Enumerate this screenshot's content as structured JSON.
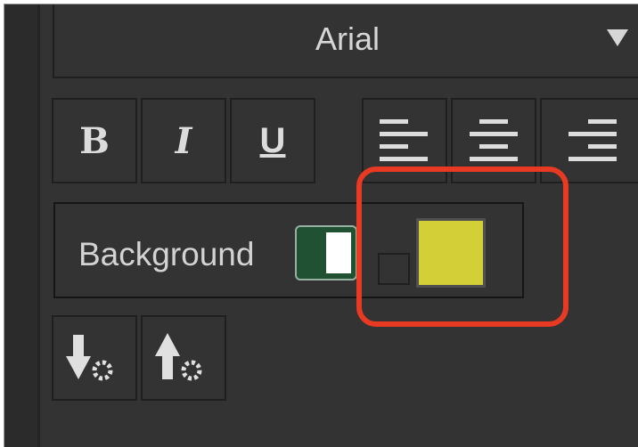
{
  "toolbar": {
    "font": {
      "value": "Arial"
    },
    "format_buttons": {
      "bold_label": "B",
      "italic_label": "I",
      "underline_label": "U"
    },
    "align_buttons": [
      "align-left",
      "align-center",
      "align-right"
    ],
    "background": {
      "label": "Background",
      "toggle_on": true,
      "color": "#d2d036",
      "toggle_color": "#1f5132"
    },
    "order_buttons": [
      "send-backward",
      "bring-forward"
    ]
  },
  "annotation": {
    "color": "#e83a22"
  }
}
